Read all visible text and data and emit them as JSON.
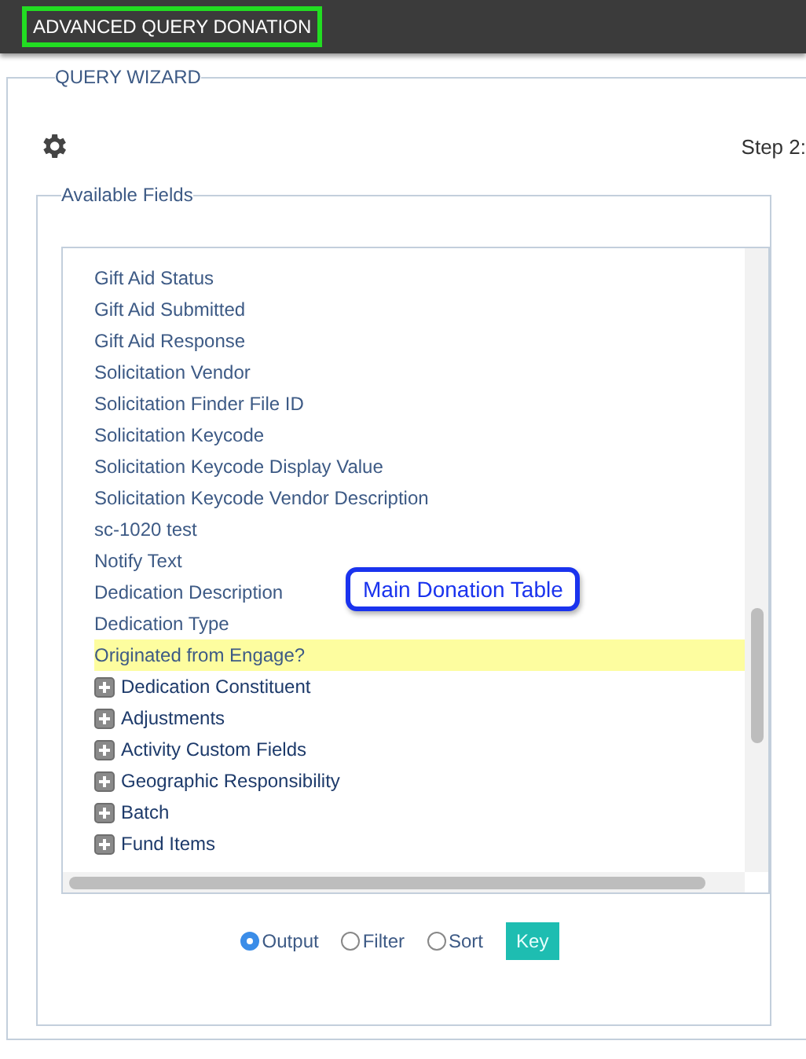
{
  "header": {
    "title": "ADVANCED QUERY DONATION"
  },
  "wizard": {
    "legend": "QUERY WIZARD",
    "step": "Step 2:"
  },
  "available_fields": {
    "legend": "Available Fields",
    "items": [
      {
        "label": "Gift Aid Status",
        "kind": "field",
        "selected": false
      },
      {
        "label": "Gift Aid Submitted",
        "kind": "field",
        "selected": false
      },
      {
        "label": "Gift Aid Response",
        "kind": "field",
        "selected": false
      },
      {
        "label": "Solicitation Vendor",
        "kind": "field",
        "selected": false
      },
      {
        "label": "Solicitation Finder File ID",
        "kind": "field",
        "selected": false
      },
      {
        "label": "Solicitation Keycode",
        "kind": "field",
        "selected": false
      },
      {
        "label": "Solicitation Keycode Display Value",
        "kind": "field",
        "selected": false
      },
      {
        "label": "Solicitation Keycode Vendor Description",
        "kind": "field",
        "selected": false
      },
      {
        "label": "sc-1020 test",
        "kind": "field",
        "selected": false
      },
      {
        "label": "Notify Text",
        "kind": "field",
        "selected": false
      },
      {
        "label": "Dedication Description",
        "kind": "field",
        "selected": false
      },
      {
        "label": "Dedication Type",
        "kind": "field",
        "selected": false
      },
      {
        "label": "Originated from Engage?",
        "kind": "field",
        "selected": true
      },
      {
        "label": "Dedication Constituent",
        "kind": "group",
        "expanded": false
      },
      {
        "label": "Adjustments",
        "kind": "group",
        "expanded": false
      },
      {
        "label": "Activity Custom Fields",
        "kind": "group",
        "expanded": false
      },
      {
        "label": "Geographic Responsibility",
        "kind": "group",
        "expanded": false
      },
      {
        "label": "Batch",
        "kind": "group",
        "expanded": false
      },
      {
        "label": "Fund Items",
        "kind": "group",
        "expanded": false
      }
    ],
    "tooltip": "Main Donation Table"
  },
  "modes": [
    {
      "label": "Output",
      "selected": true
    },
    {
      "label": "Filter",
      "selected": false
    },
    {
      "label": "Sort",
      "selected": false
    }
  ],
  "key_button": "Key"
}
